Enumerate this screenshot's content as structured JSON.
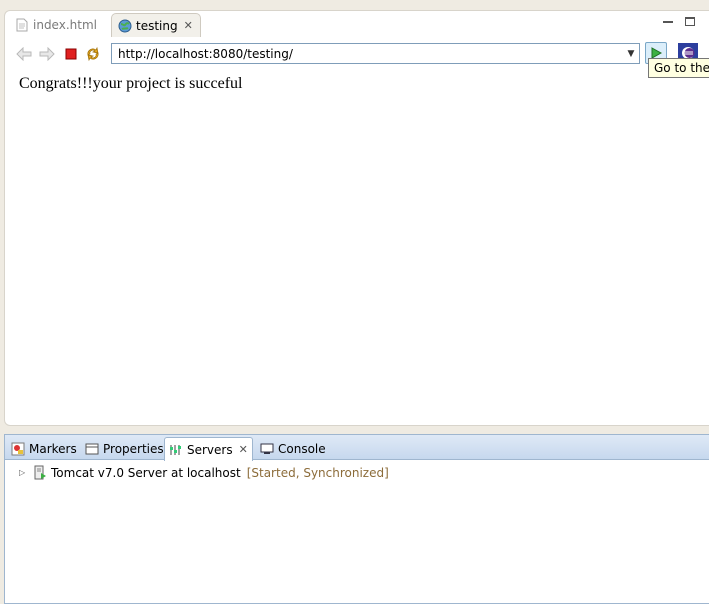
{
  "editor": {
    "tabs": [
      {
        "label": "index.html",
        "icon": "html-file-icon",
        "active": false
      },
      {
        "label": "testing",
        "icon": "globe-icon",
        "active": true
      }
    ]
  },
  "browser": {
    "url": "http://localhost:8080/testing/",
    "tooltip": "Go to the s",
    "page_text": "Congrats!!!your project is succeful"
  },
  "panel": {
    "tabs": [
      {
        "label": "Markers",
        "icon": "markers-icon"
      },
      {
        "label": "Properties",
        "icon": "properties-icon"
      },
      {
        "label": "Servers",
        "icon": "servers-icon",
        "active": true
      },
      {
        "label": "Console",
        "icon": "console-icon"
      }
    ],
    "server": {
      "name": "Tomcat v7.0 Server at localhost",
      "status": "[Started, Synchronized]"
    }
  },
  "colors": {
    "background": "#efebe2",
    "panel_header": "#c6d8ee",
    "status_text": "#8c6c3a",
    "tooltip_bg": "#ffffe1"
  }
}
